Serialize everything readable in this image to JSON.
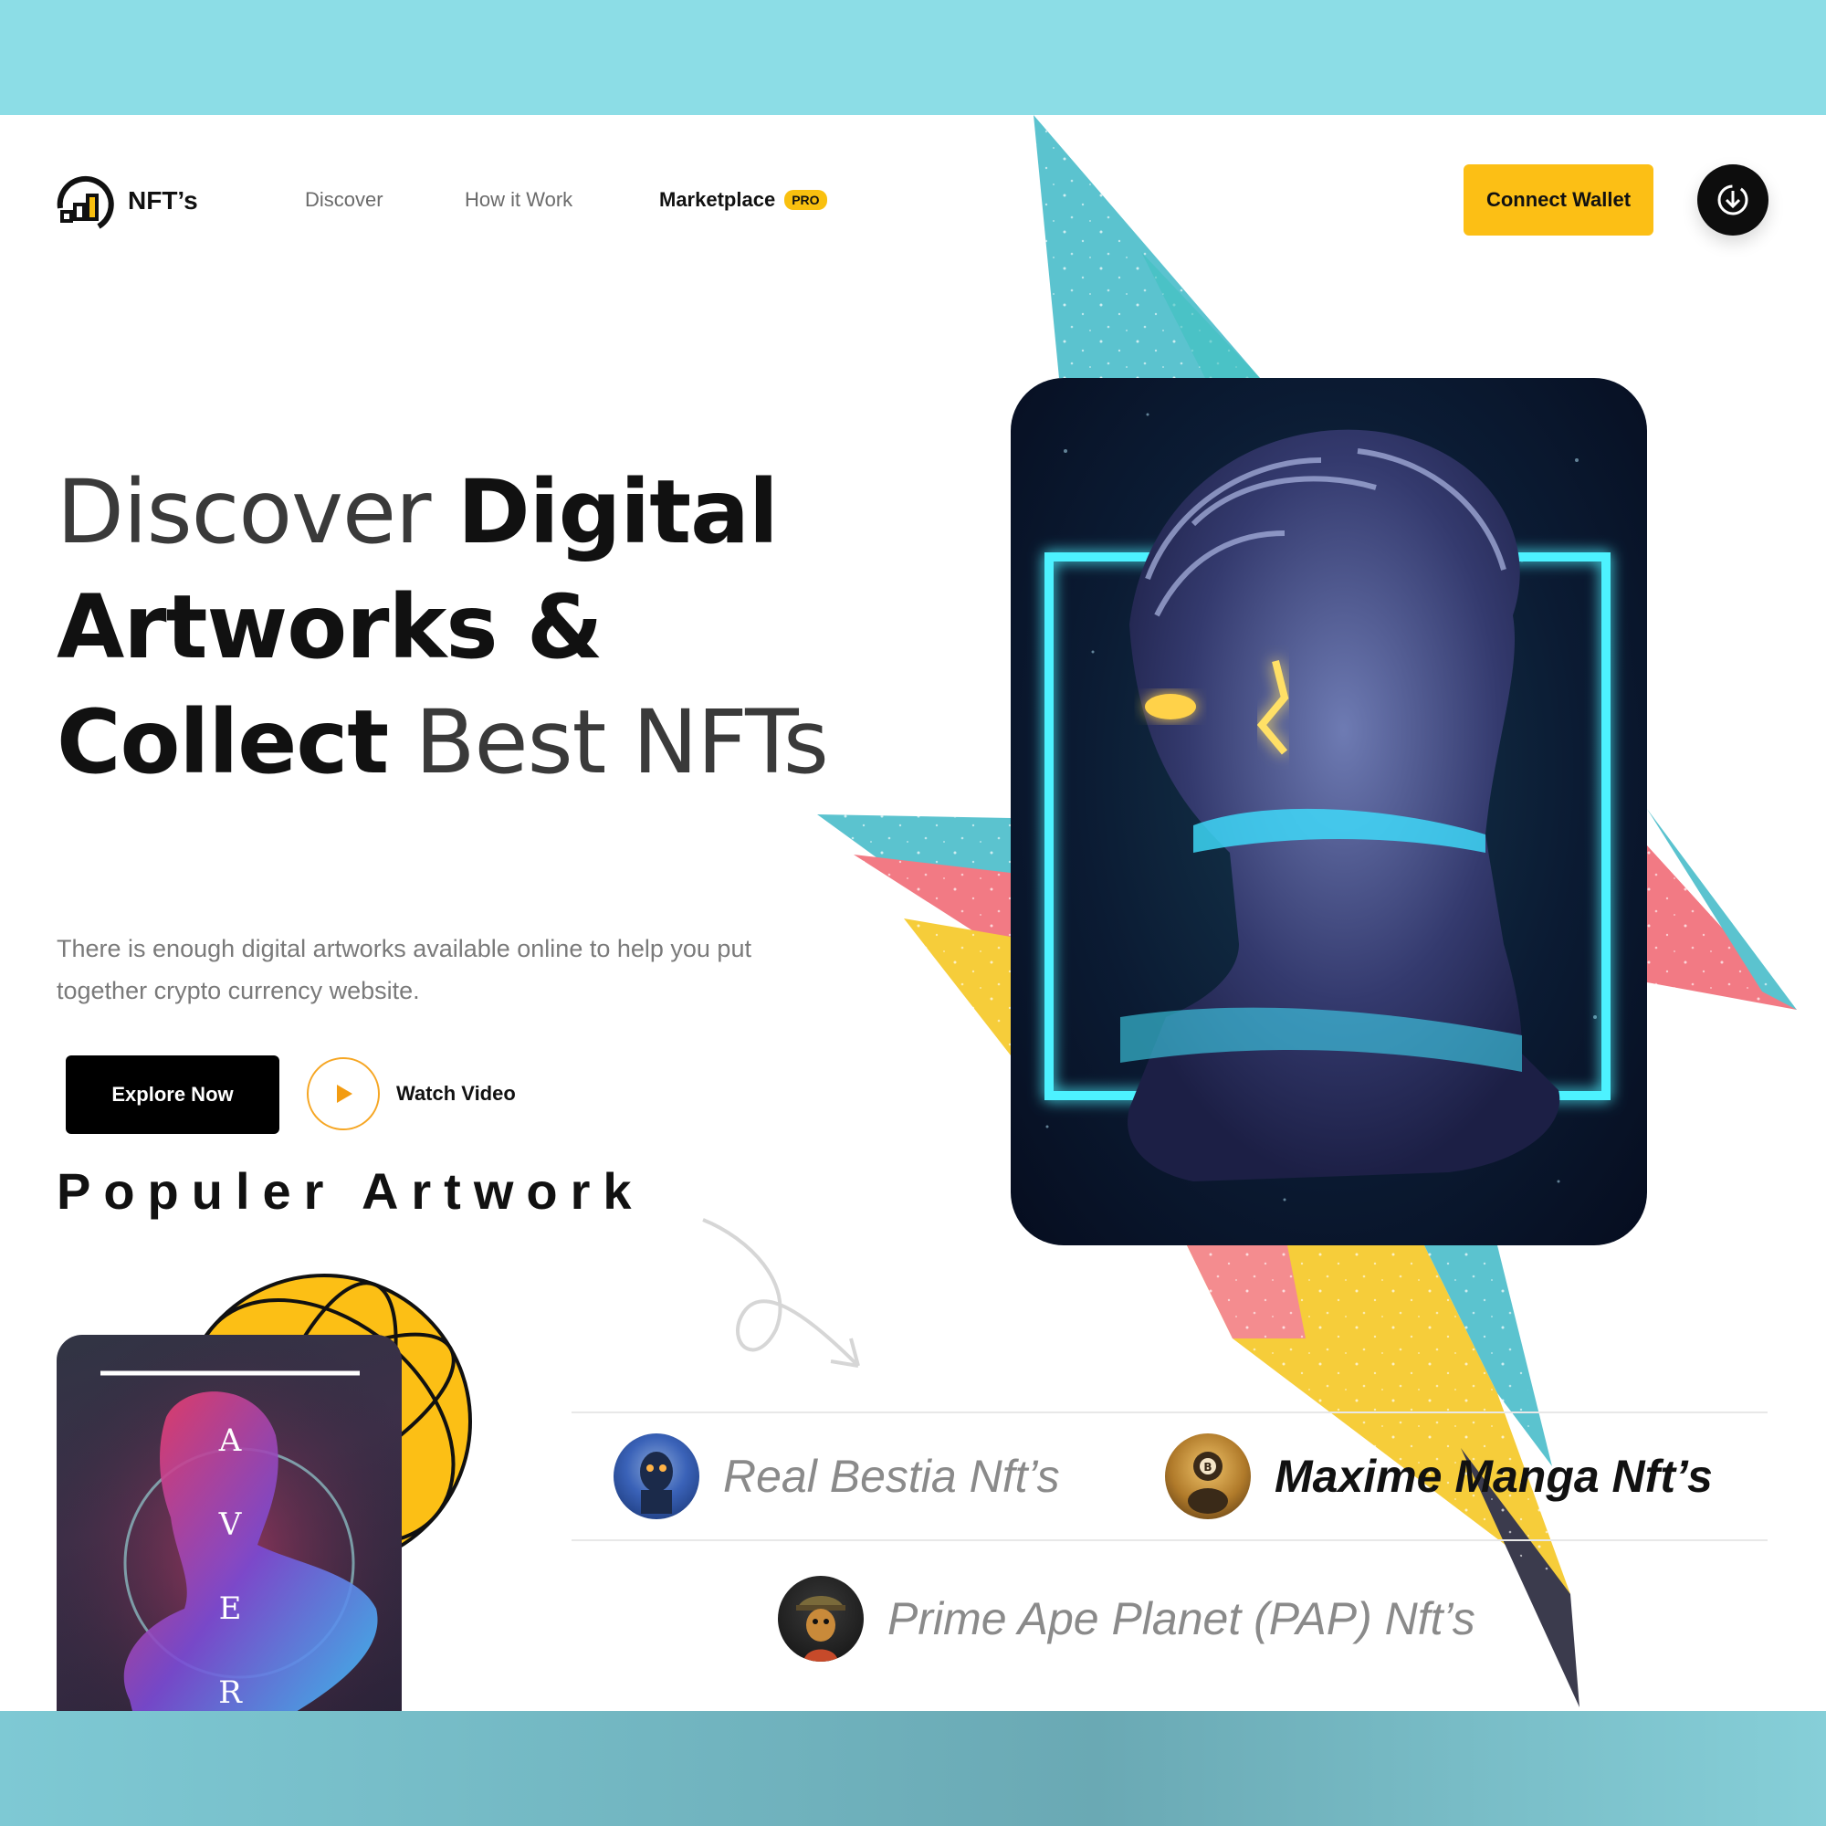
{
  "brand": {
    "name": "NFT’s"
  },
  "nav": {
    "discover": "Discover",
    "how_it_work": "How it Work",
    "marketplace": "Marketplace",
    "pro_badge": "PRO"
  },
  "header": {
    "connect_wallet": "Connect Wallet"
  },
  "hero": {
    "title_w1": "Discover",
    "title_w2": "Digital",
    "title_w3": "Artworks &",
    "title_w4": "Collect",
    "title_w5": "Best NFTs",
    "description": "There is enough digital artworks available online to help you put together crypto currency website.",
    "explore_label": "Explore Now",
    "watch_label": "Watch Video"
  },
  "popular": {
    "title": "Populer Artwork",
    "card_letters": [
      "A",
      "V",
      "E",
      "R"
    ]
  },
  "collections": [
    {
      "name": "Real Bestia Nft’s",
      "active": false
    },
    {
      "name": "Maxime Manga Nft’s",
      "active": true
    },
    {
      "name": "Prime Ape Planet (PAP)  Nft’s",
      "active": false
    }
  ],
  "colors": {
    "accent": "#fcbf15",
    "background": "#8cdde6",
    "dark": "#000000",
    "teal": "#5bc3cf",
    "pink": "#f27a84",
    "yellow": "#f6cd3a"
  },
  "icons": {
    "logo": "chart-logo-icon",
    "download": "download-icon",
    "play": "play-icon",
    "arrow": "curly-arrow-icon"
  }
}
